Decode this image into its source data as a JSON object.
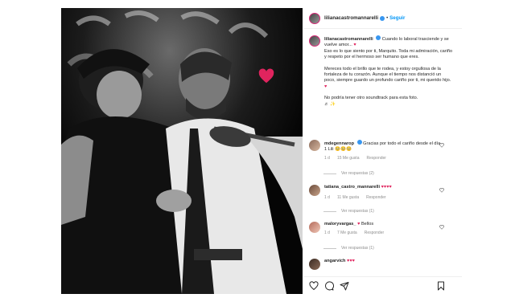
{
  "post": {
    "username": "lilianacastromannarelli",
    "follow_label": "Seguir",
    "dot": "•"
  },
  "caption": {
    "username": "lilianacastromannarelli",
    "line1": "Cuando lo laboral trasciende y se vuelve amor...",
    "line2": "Eso es lo que siento por ti, Marquito. Toda mi admiración, cariño y respeto por el hermoso ser humano que eres.",
    "para2": "Mereces todo el brillo que te rodea, y estoy orgullosa de la fortaleza de tu corazón. Aunque el tiempo nos distanció un poco, siempre guardo un profundo cariño por ti, mi querido hijo.",
    "para3": "No podría tener otro soundtrack para esta foto."
  },
  "comments": [
    {
      "username": "mdegennarop",
      "text": "Gracias por todo el cariño desde el día 1 Lili",
      "emoji_text": "🥺🥺🥺",
      "time": "1 d",
      "likes": "15 Me gusta",
      "reply": "Responder",
      "view_replies": "Ver respuestas (2)"
    },
    {
      "username": "tatiana_castro_mannarelli",
      "text": "",
      "time": "1 d",
      "likes": "11 Me gusta",
      "reply": "Responder",
      "view_replies": "Ver respuestas (1)"
    },
    {
      "username": "maloryvargas_",
      "text": "Bellos",
      "time": "1 d",
      "likes": "7 Me gusta",
      "reply": "Responder",
      "view_replies": "Ver respuestas (1)"
    },
    {
      "username": "angarvich",
      "text": "",
      "time": "",
      "likes": "",
      "reply": ""
    }
  ],
  "icons": {
    "like": "heart-outline-icon",
    "comment": "speech-bubble-icon",
    "share": "paper-plane-icon",
    "save": "bookmark-icon",
    "sticker": "red-heart-icon"
  },
  "colors": {
    "link_blue": "#0095f6",
    "verified_blue": "#3897f0",
    "heart_red": "#e0245e",
    "muted": "#8e8e8e"
  }
}
